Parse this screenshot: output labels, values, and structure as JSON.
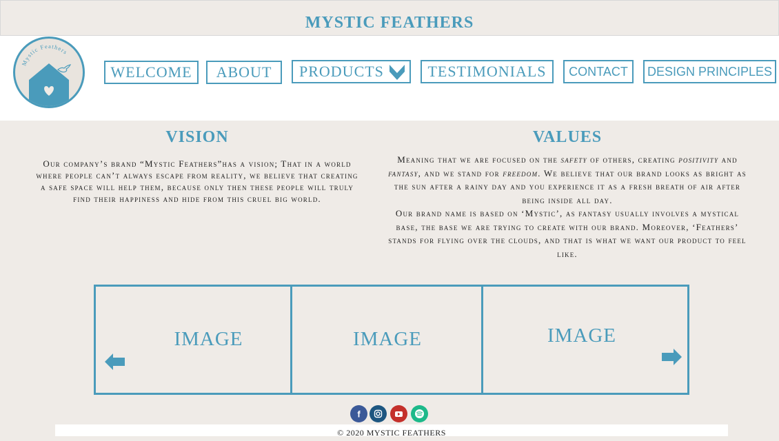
{
  "site": {
    "title": "MYSTIC FEATHERS",
    "logo_text": "Mystic Feathers",
    "accent": "#4a9bbb"
  },
  "nav": {
    "welcome": "WELCOME",
    "about": "ABOUT",
    "products": "PRODUCTS",
    "testimonials": "TESTIMONIALS",
    "contact": "CONTACT",
    "design_principles": "DESIGN PRINCIPLES"
  },
  "vision": {
    "title": "VISION",
    "text": "Our company’s brand “Mystic Feathers”has a vision; That in a world where people can’t always escape from reality, we believe that creating a safe space will help them, because only then these people will truly find their happiness and hide from this cruel big world."
  },
  "values": {
    "title": "VALUES",
    "p1_a": "Meaning that we are focused on the ",
    "p1_safety": "safety",
    "p1_b": " of others, creating ",
    "p1_positivity": "positivity",
    "p1_c": " and ",
    "p1_fantasy": "fantasy",
    "p1_d": ", and we stand for ",
    "p1_freedom": "freedom",
    "p1_e": ". We believe that our brand looks as bright as the sun after a rainy day and you experience it as a fresh breath of air after being inside all day.",
    "p2": "Our brand name is based on ‘Mystic’, as fantasy usually involves a mystical base, the base we are trying to create with our brand. Moreover, ‘Feathers’ stands for flying over the clouds, and that is what we want our product to feel like."
  },
  "gallery": {
    "items": [
      "IMAGE",
      "IMAGE",
      "IMAGE"
    ]
  },
  "social": {
    "facebook": "#3b5998",
    "instagram": "#1d5680",
    "youtube": "#c4302b",
    "spotify": "#1db98a"
  },
  "footer": {
    "copyright": "© 2020 MYSTIC FEATHERS"
  }
}
